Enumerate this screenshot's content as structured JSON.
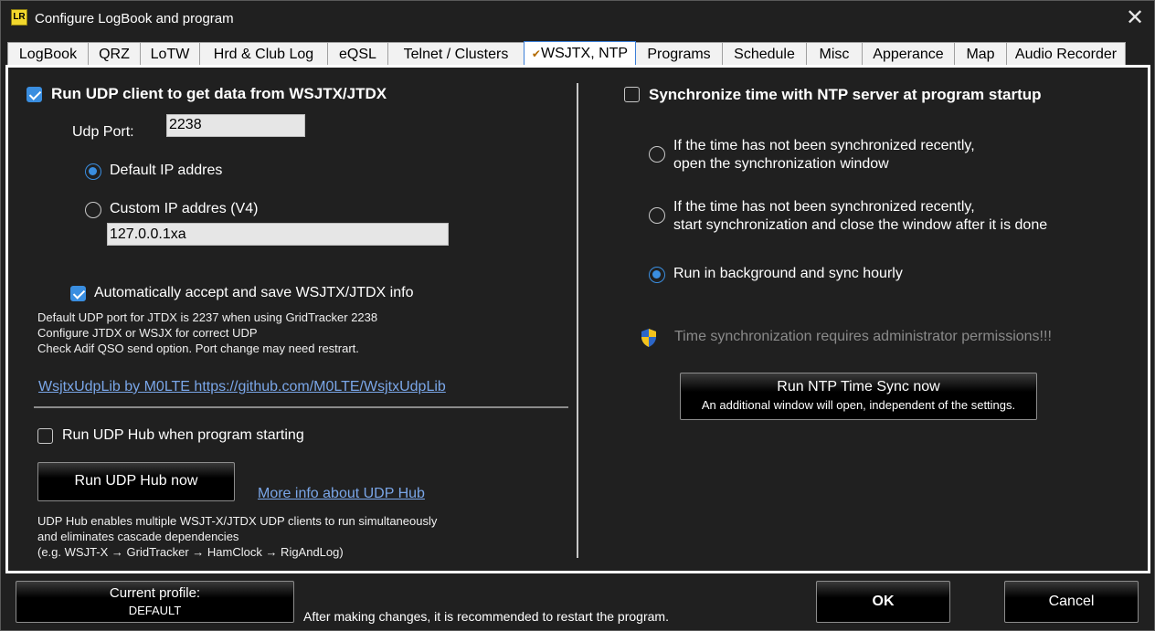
{
  "window": {
    "title": "Configure LogBook and program",
    "app_icon_text": "LR",
    "close_glyph": "✕"
  },
  "tabs": [
    {
      "label": "LogBook"
    },
    {
      "label": "QRZ"
    },
    {
      "label": "LoTW"
    },
    {
      "label": "Hrd & Club Log"
    },
    {
      "label": "eQSL"
    },
    {
      "label": "Telnet / Clusters"
    },
    {
      "label": "WSJTX, NTP",
      "active": true
    },
    {
      "label": "Programs"
    },
    {
      "label": "Schedule"
    },
    {
      "label": "Misc"
    },
    {
      "label": "Apperance"
    },
    {
      "label": "Map"
    },
    {
      "label": "Audio Recorder"
    }
  ],
  "wsjtx": {
    "run_udp_label": "Run UDP client to get data  from WSJTX/JTDX",
    "run_udp_checked": true,
    "udp_port_label": "Udp Port:",
    "udp_port_value": "2238",
    "default_ip_label": "Default IP addres",
    "custom_ip_label": "Custom IP addres (V4)",
    "custom_ip_value": "127.0.0.1xa",
    "auto_accept_label": "Automatically accept and save WSJTX/JTDX info",
    "auto_accept_checked": true,
    "note_line1": "Default UDP port for JTDX is 2237 when using GridTracker 2238",
    "note_line2": "Configure JTDX or WSJX for correct UDP",
    "note_line3": "Check Adif QSO send option. Port change may need restrart.",
    "lib_link": "WsjtxUdpLib by M0LTE https://github.com/M0LTE/WsjtxUdpLib",
    "run_hub_label": "Run UDP Hub when program starting",
    "run_hub_checked": false,
    "run_hub_button": "Run UDP Hub now",
    "hub_info_link": "More info about UDP Hub",
    "hub_note_line1": "UDP Hub enables multiple WSJT-X/JTDX UDP clients to run simultaneously",
    "hub_note_line2": "and eliminates cascade dependencies",
    "hub_note_line3": "(e.g. WSJT-X → GridTracker → HamClock → RigAndLog)"
  },
  "ntp": {
    "sync_startup_label": "Synchronize time with NTP server at program startup",
    "sync_startup_checked": false,
    "opt1_line1": "If the time has not been synchronized recently,",
    "opt1_line2": "open the synchronization window",
    "opt2_line1": "If the time has not been synchronized recently,",
    "opt2_line2": "start synchronization and close the window after it is done",
    "opt3_label": "Run in background and sync hourly",
    "selected_option": 3,
    "admin_note": "Time synchronization requires administrator permissions!!!",
    "admin_icon": "uac-shield-icon",
    "sync_button_title": "Run NTP Time Sync now",
    "sync_button_sub": "An additional window will open, independent of the settings."
  },
  "footer": {
    "profile_title": "Current profile:",
    "profile_value": "DEFAULT",
    "restart_note": "After making changes, it is recommended to restart the program.",
    "ok_label": "OK",
    "cancel_label": "Cancel"
  },
  "colors": {
    "background": "#202020",
    "accent": "#3a8ee0",
    "link": "#7aa6e8",
    "shield_blue": "#2c66c8",
    "shield_yellow": "#f2c21b"
  }
}
